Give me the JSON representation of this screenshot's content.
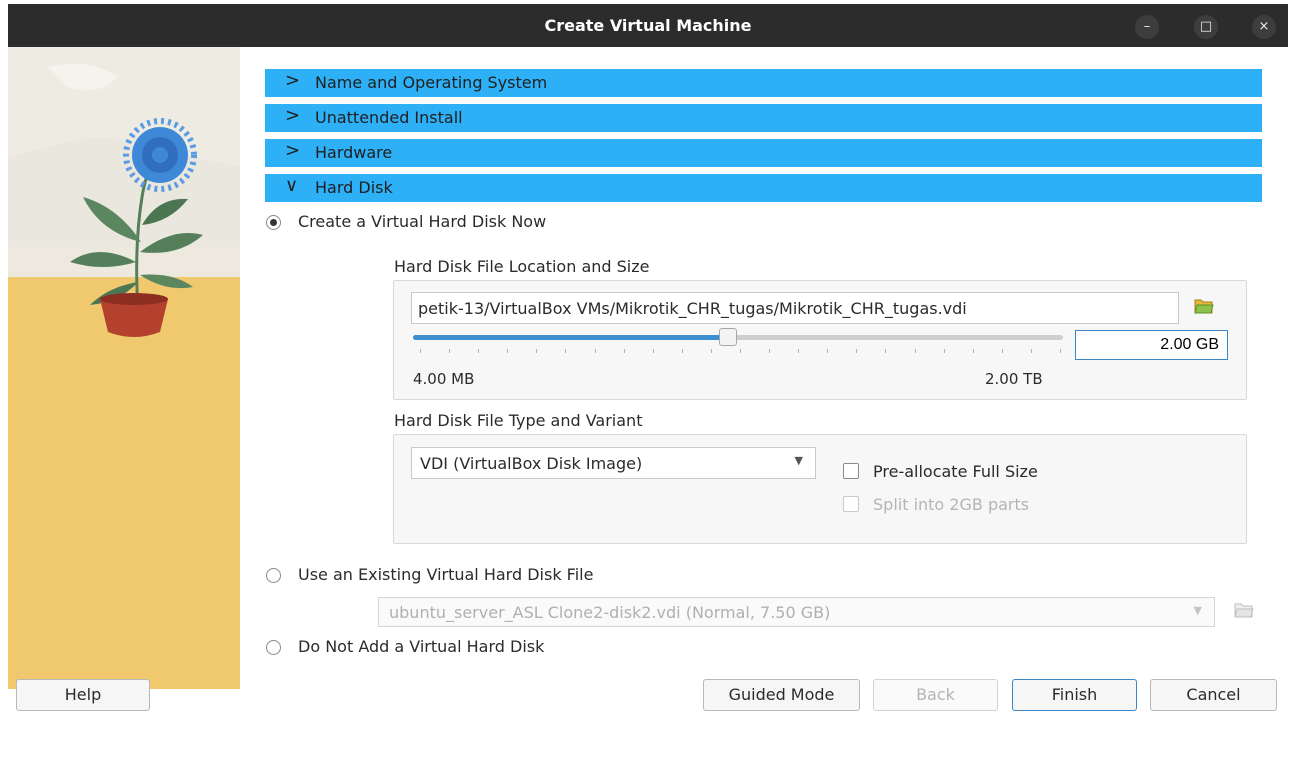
{
  "window": {
    "title": "Create Virtual Machine",
    "controls": {
      "minimize": "–",
      "maximize": "□",
      "close": "×"
    }
  },
  "sections": [
    {
      "label": "Name and Operating System",
      "expanded": false
    },
    {
      "label": "Unattended Install",
      "expanded": false
    },
    {
      "label": "Hardware",
      "expanded": false
    },
    {
      "label": "Hard Disk",
      "expanded": true
    }
  ],
  "chevrons": {
    "collapsed": ">",
    "expanded": "∨"
  },
  "hard_disk": {
    "create_now": {
      "label": "Create a Virtual Hard Disk Now",
      "checked": true
    },
    "location_title": "Hard Disk File Location and Size",
    "file_path": "petik-13/VirtualBox VMs/Mikrotik_CHR_tugas/Mikrotik_CHR_tugas.vdi",
    "size": {
      "value": "2.00 GB",
      "min_label": "4.00 MB",
      "max_label": "2.00 TB",
      "slider_fraction": 0.47
    },
    "type_title": "Hard Disk File Type and Variant",
    "file_type": "VDI (VirtualBox Disk Image)",
    "preallocate": {
      "label": "Pre-allocate Full Size",
      "checked": false
    },
    "split": {
      "label": "Split into 2GB parts",
      "checked": false,
      "disabled": true
    },
    "use_existing": {
      "label": "Use an Existing Virtual Hard Disk File",
      "checked": false
    },
    "existing_file": "ubuntu_server_ASL Clone2-disk2.vdi (Normal, 7.50 GB)",
    "no_disk": {
      "label": "Do Not Add a Virtual Hard Disk",
      "checked": false
    }
  },
  "buttons": {
    "help": "Help",
    "guided_mode": "Guided Mode",
    "back": "Back",
    "finish": "Finish",
    "cancel": "Cancel"
  },
  "colors": {
    "accent": "#2eb0f6",
    "titlebar": "#2c2c2c",
    "art_sand": "#f0c96f",
    "art_flower": "#3f88d8",
    "art_pot": "#b4412e",
    "art_leaf": "#557f5a"
  },
  "icons": {
    "folder": "folder-open-icon",
    "dropdown": "chevron-down-icon"
  }
}
